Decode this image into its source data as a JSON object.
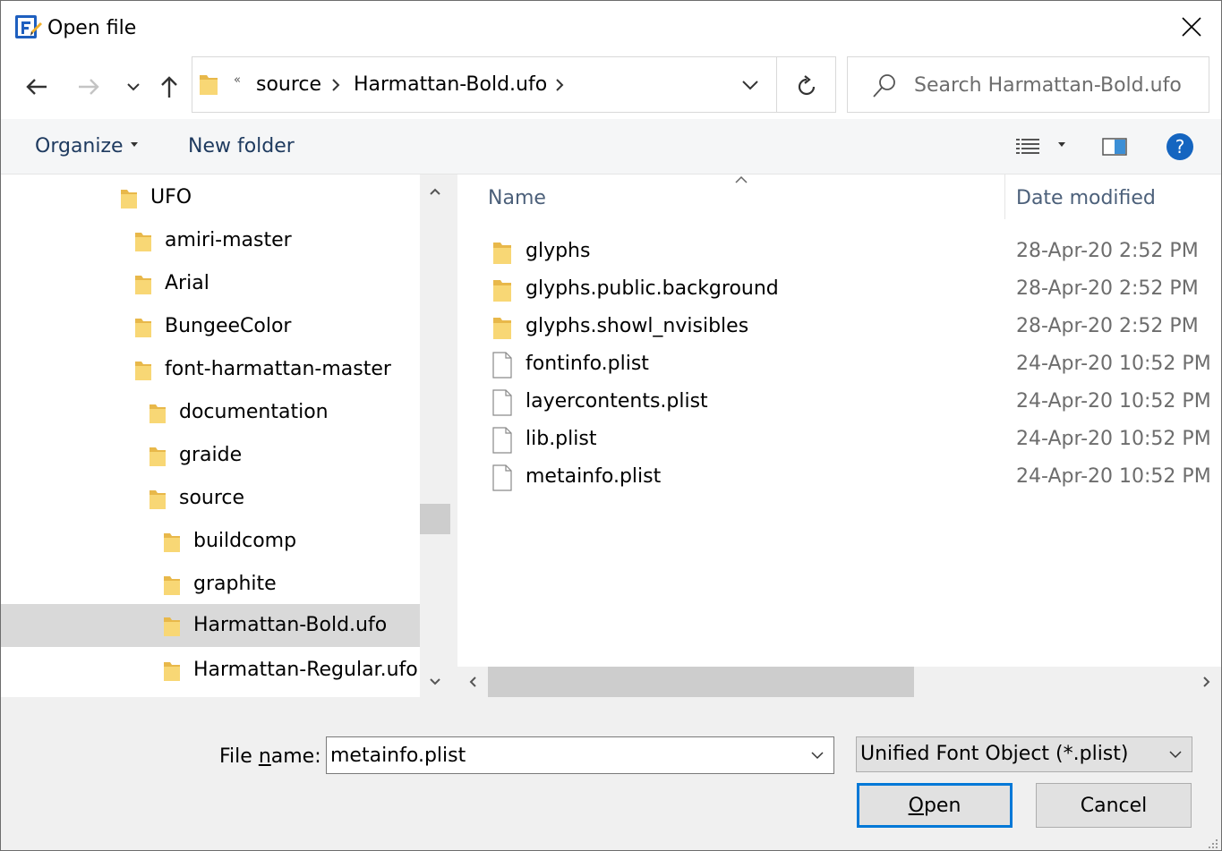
{
  "window": {
    "title": "Open file"
  },
  "nav": {
    "address": {
      "overflow": "«",
      "crumbs": [
        "source",
        "Harmattan-Bold.ufo"
      ]
    },
    "search": {
      "placeholder": "Search Harmattan-Bold.ufo"
    }
  },
  "toolbar": {
    "organize_label": "Organize",
    "new_folder_label": "New folder",
    "help_label": "?"
  },
  "tree": {
    "items": [
      {
        "label": "UFO"
      },
      {
        "label": "amiri-master"
      },
      {
        "label": "Arial"
      },
      {
        "label": "BungeeColor"
      },
      {
        "label": "font-harmattan-master"
      },
      {
        "label": "documentation"
      },
      {
        "label": "graide"
      },
      {
        "label": "source"
      },
      {
        "label": "buildcomp"
      },
      {
        "label": "graphite"
      },
      {
        "label": "Harmattan-Bold.ufo"
      },
      {
        "label": "Harmattan-Regular.ufo"
      }
    ]
  },
  "filelist": {
    "columns": {
      "name": "Name",
      "date": "Date modified"
    },
    "rows": [
      {
        "name": "glyphs",
        "date": "28-Apr-20 2:52 PM",
        "kind": "folder"
      },
      {
        "name": "glyphs.public.background",
        "date": "28-Apr-20 2:52 PM",
        "kind": "folder"
      },
      {
        "name": "glyphs.showl_nvisibles",
        "date": "28-Apr-20 2:52 PM",
        "kind": "folder"
      },
      {
        "name": "fontinfo.plist",
        "date": "24-Apr-20 10:52 PM",
        "kind": "file"
      },
      {
        "name": "layercontents.plist",
        "date": "24-Apr-20 10:52 PM",
        "kind": "file"
      },
      {
        "name": "lib.plist",
        "date": "24-Apr-20 10:52 PM",
        "kind": "file"
      },
      {
        "name": "metainfo.plist",
        "date": "24-Apr-20 10:52 PM",
        "kind": "file"
      }
    ]
  },
  "bottom": {
    "file_name_label_pre": "File ",
    "file_name_label_ul": "n",
    "file_name_label_post": "ame:",
    "file_name_value": "metainfo.plist",
    "file_type_value": "Unified Font Object (*.plist)",
    "open_label_ul": "O",
    "open_label_rest": "pen",
    "cancel_label": "Cancel"
  },
  "colors": {
    "folder": "#f8d775",
    "accent": "#0078d7",
    "selected": "#d9d9d9",
    "help": "#1565c0"
  }
}
